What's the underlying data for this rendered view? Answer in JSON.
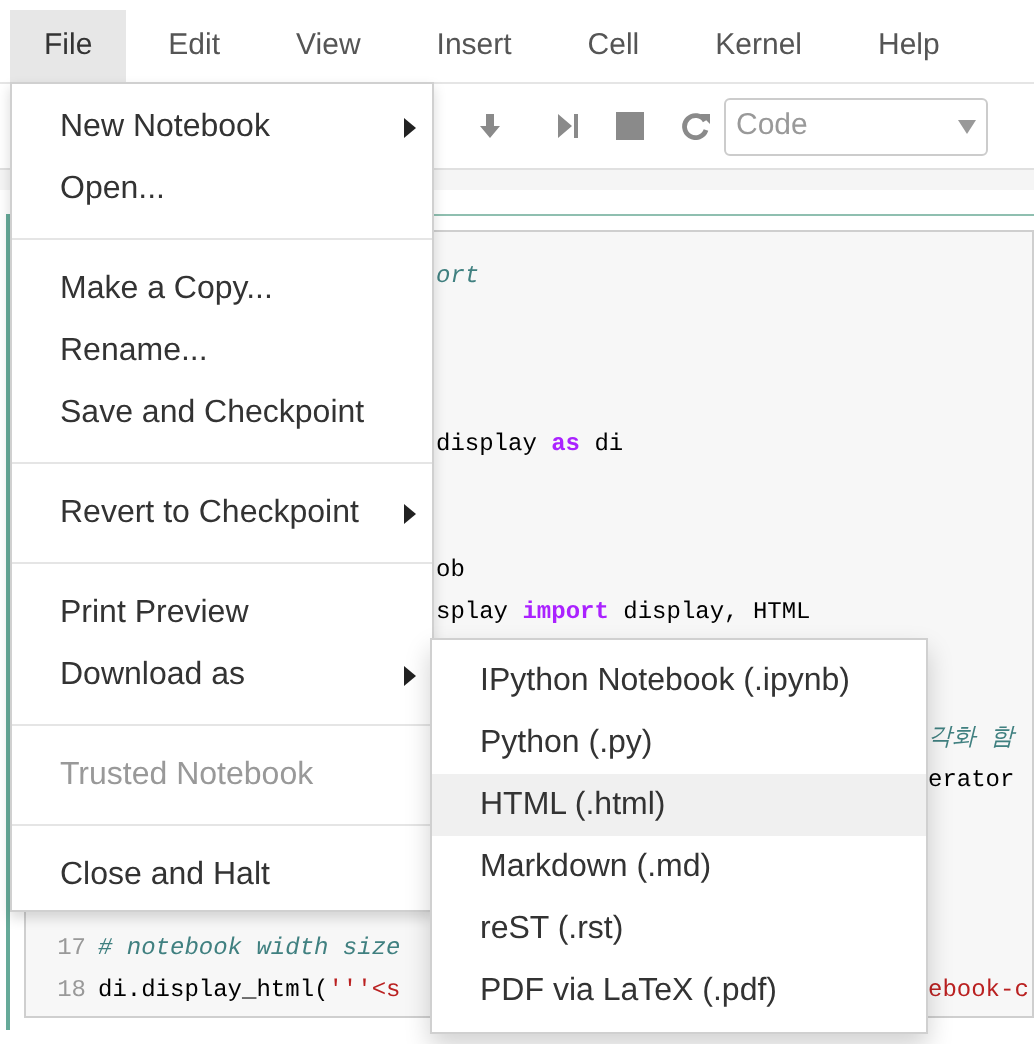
{
  "menubar": [
    {
      "label": "File",
      "selected": true
    },
    {
      "label": "Edit",
      "selected": false
    },
    {
      "label": "View",
      "selected": false
    },
    {
      "label": "Insert",
      "selected": false
    },
    {
      "label": "Cell",
      "selected": false
    },
    {
      "label": "Kernel",
      "selected": false
    },
    {
      "label": "Help",
      "selected": false
    }
  ],
  "toolbar": {
    "cell_type": {
      "value": "Code"
    }
  },
  "file_menu": [
    {
      "kind": "item",
      "label": "New Notebook",
      "submenu": true,
      "disabled": false
    },
    {
      "kind": "item",
      "label": "Open...",
      "submenu": false,
      "disabled": false
    },
    {
      "kind": "divider"
    },
    {
      "kind": "item",
      "label": "Make a Copy...",
      "submenu": false,
      "disabled": false
    },
    {
      "kind": "item",
      "label": "Rename...",
      "submenu": false,
      "disabled": false
    },
    {
      "kind": "item",
      "label": "Save and Checkpoint",
      "submenu": false,
      "disabled": false
    },
    {
      "kind": "divider"
    },
    {
      "kind": "item",
      "label": "Revert to Checkpoint",
      "submenu": true,
      "disabled": false
    },
    {
      "kind": "divider"
    },
    {
      "kind": "item",
      "label": "Print Preview",
      "submenu": false,
      "disabled": false
    },
    {
      "kind": "item",
      "label": "Download as",
      "submenu": true,
      "disabled": false
    },
    {
      "kind": "divider"
    },
    {
      "kind": "item",
      "label": "Trusted Notebook",
      "submenu": false,
      "disabled": true
    },
    {
      "kind": "divider"
    },
    {
      "kind": "item",
      "label": "Close and Halt",
      "submenu": false,
      "disabled": false
    }
  ],
  "download_submenu": [
    {
      "label": "IPython Notebook (.ipynb)",
      "selected": false
    },
    {
      "label": "Python (.py)",
      "selected": false
    },
    {
      "label": "HTML (.html)",
      "selected": true
    },
    {
      "label": "Markdown (.md)",
      "selected": false
    },
    {
      "label": "reST (.rst)",
      "selected": false
    },
    {
      "label": "PDF via LaTeX (.pdf)",
      "selected": false
    }
  ],
  "code_lines": [
    {
      "beside_file_menu": [
        {
          "kind": "comment",
          "text": "ort"
        }
      ]
    },
    {
      "beside_file_menu": [
        {
          "kind": "plain",
          "text": "display "
        },
        {
          "kind": "keyword",
          "text": "as"
        },
        {
          "kind": "plain",
          "text": " di"
        }
      ]
    },
    {
      "beside_file_menu": [
        {
          "kind": "plain",
          "text": "ob"
        }
      ]
    },
    {
      "beside_file_menu": [
        {
          "kind": "plain",
          "text": "splay "
        },
        {
          "kind": "keyword",
          "text": "import"
        },
        {
          "kind": "plain",
          "text": " display, HTML"
        }
      ]
    },
    {
      "beside_submenu": [
        {
          "kind": "comment",
          "text": "각화 함"
        }
      ]
    },
    {
      "beside_submenu": [
        {
          "kind": "plain",
          "text": "erator"
        }
      ]
    },
    {
      "number": "17",
      "code": [
        {
          "kind": "comment",
          "text": "# notebook width size"
        }
      ]
    },
    {
      "number": "18",
      "code": [
        {
          "kind": "plain",
          "text": "di.display_html("
        },
        {
          "kind": "string",
          "text": "'''<s"
        }
      ],
      "beside_submenu": [
        {
          "kind": "string",
          "text": "ebook-c"
        }
      ]
    }
  ]
}
